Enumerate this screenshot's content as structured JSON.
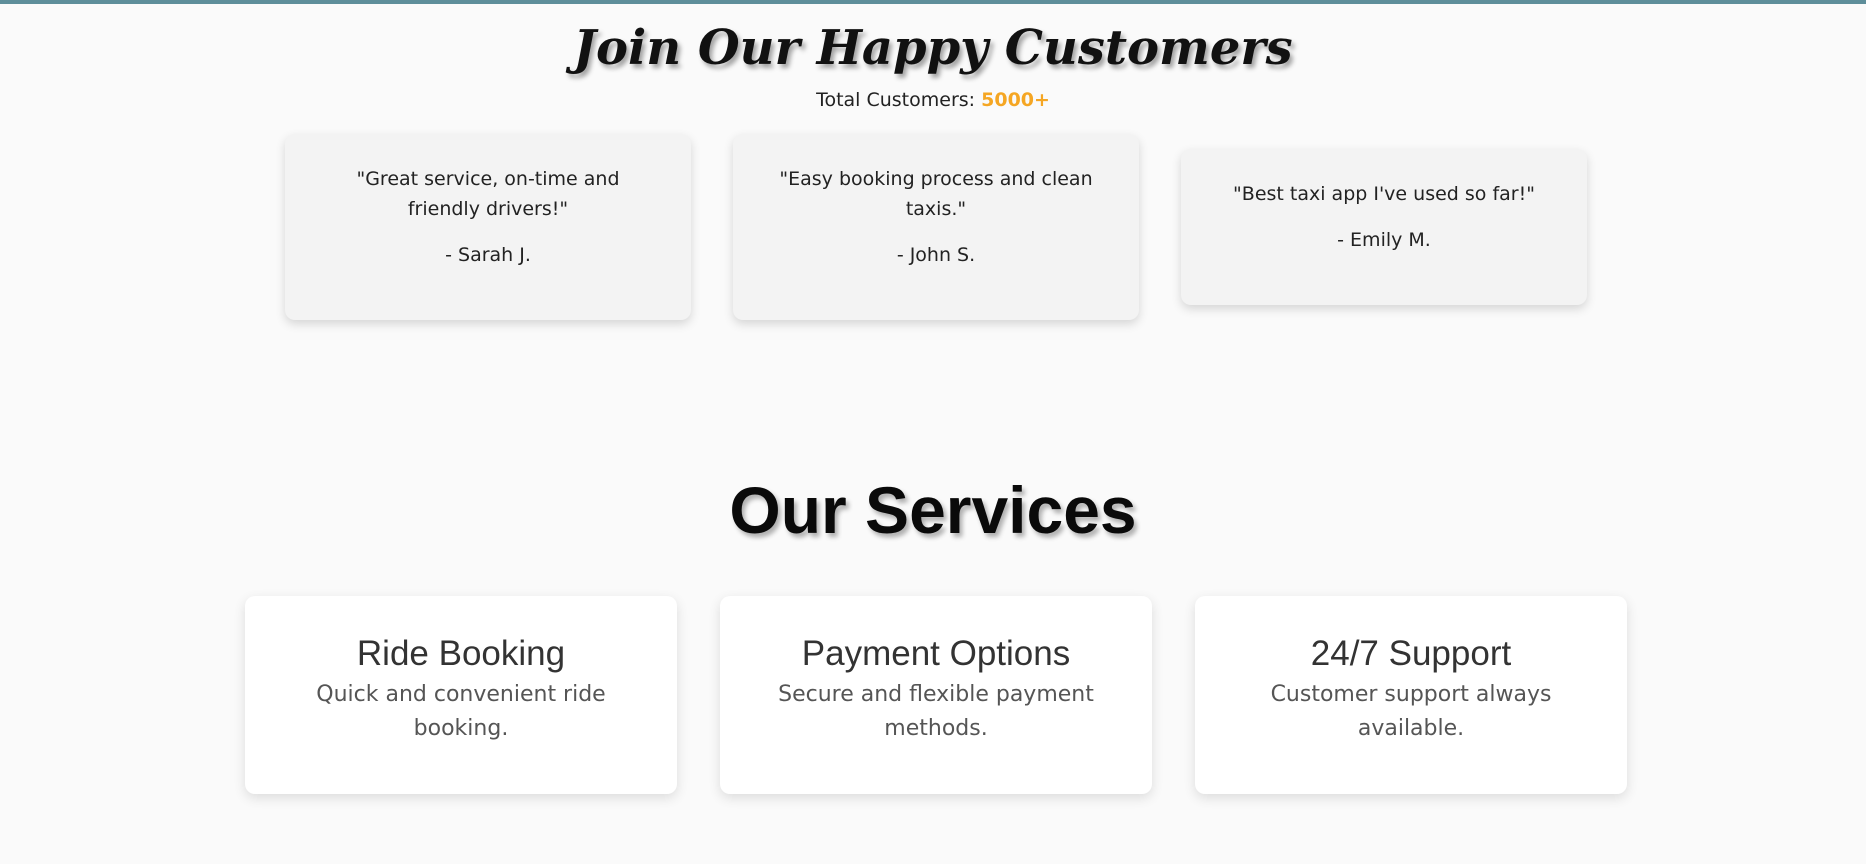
{
  "customers": {
    "title": "Join Our Happy Customers",
    "total_label": "Total Customers:",
    "total_value": "5000+",
    "testimonials": [
      {
        "quote": "\"Great service, on-time and friendly drivers!\"",
        "author": "- Sarah J."
      },
      {
        "quote": "\"Easy booking process and clean taxis.\"",
        "author": "- John S."
      },
      {
        "quote": "\"Best taxi app I've used so far!\"",
        "author": "- Emily M."
      }
    ]
  },
  "services": {
    "title": "Our Services",
    "cards": [
      {
        "title": "Ride Booking",
        "description": "Quick and convenient ride booking."
      },
      {
        "title": "Payment Options",
        "description": "Secure and flexible payment methods."
      },
      {
        "title": "24/7 Support",
        "description": "Customer support always available."
      }
    ]
  },
  "colors": {
    "top_bar": "#5e8e9a",
    "accent": "#f5a623",
    "background": "#fafafa",
    "testimonial_card": "#f3f3f3",
    "service_card": "#ffffff"
  }
}
